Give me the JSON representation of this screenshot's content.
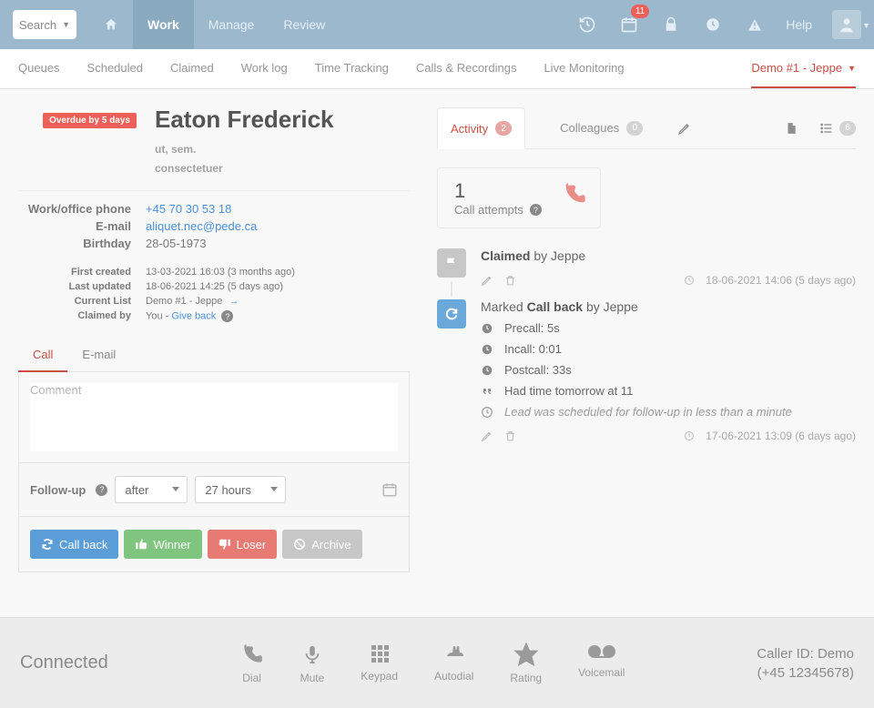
{
  "search": {
    "label": "Search"
  },
  "nav": {
    "work": "Work",
    "manage": "Manage",
    "review": "Review"
  },
  "topbar": {
    "badge": "11",
    "help": "Help"
  },
  "subnav": {
    "queues": "Queues",
    "scheduled": "Scheduled",
    "claimed": "Claimed",
    "worklog": "Work log",
    "timetracking": "Time Tracking",
    "calls": "Calls & Recordings",
    "live": "Live Monitoring",
    "demo": "Demo #1 - Jeppe"
  },
  "lead": {
    "overdue": "Overdue by 5 days",
    "name": "Eaton Frederick",
    "sub1": "ut, sem.",
    "sub2": "consectetuer",
    "phone_label": "Work/office phone",
    "phone": "+45 70 30 53 18",
    "email_label": "E-mail",
    "email": "aliquet.nec@pede.ca",
    "birthday_label": "Birthday",
    "birthday": "28-05-1973",
    "created_label": "First created",
    "created": "13-03-2021 16:03 (3 months ago)",
    "updated_label": "Last updated",
    "updated": "18-06-2021 14:25 (5 days ago)",
    "list_label": "Current List",
    "list": "Demo #1 - Jeppe",
    "claimed_label": "Claimed by",
    "claimed_prefix": "You - ",
    "claimed_link": "Give back"
  },
  "compose": {
    "tab_call": "Call",
    "tab_email": "E-mail",
    "placeholder": "Comment",
    "followup_label": "Follow-up",
    "mode": "after",
    "delay": "27 hours",
    "btn_callback": "Call back",
    "btn_winner": "Winner",
    "btn_loser": "Loser",
    "btn_archive": "Archive"
  },
  "right": {
    "tab_activity": "Activity",
    "activity_count": "2",
    "tab_colleagues": "Colleagues",
    "colleagues_count": "0",
    "list_count": "6",
    "attempts_n": "1",
    "attempts_lbl": "Call attempts",
    "ev1_action": "Claimed",
    "ev1_by": " by Jeppe",
    "ev1_time": "18-06-2021 14:06 (5 days ago)",
    "ev2_prefix": "Marked ",
    "ev2_action": "Call back",
    "ev2_by": " by Jeppe",
    "ev2_precall": "Precall: 5s",
    "ev2_incall": "Incall: 0:01",
    "ev2_postcall": "Postcall: 33s",
    "ev2_note": "Had time tomorrow at 11",
    "ev2_sched": "Lead was scheduled for follow-up in less than a minute",
    "ev2_time": "17-06-2021 13:09 (6 days ago)"
  },
  "footer": {
    "status": "Connected",
    "dial": "Dial",
    "mute": "Mute",
    "keypad": "Keypad",
    "autodial": "Autodial",
    "rating": "Rating",
    "voicemail": "Voicemail",
    "caller_id": "Caller ID: Demo",
    "caller_num": "(+45 12345678)"
  }
}
